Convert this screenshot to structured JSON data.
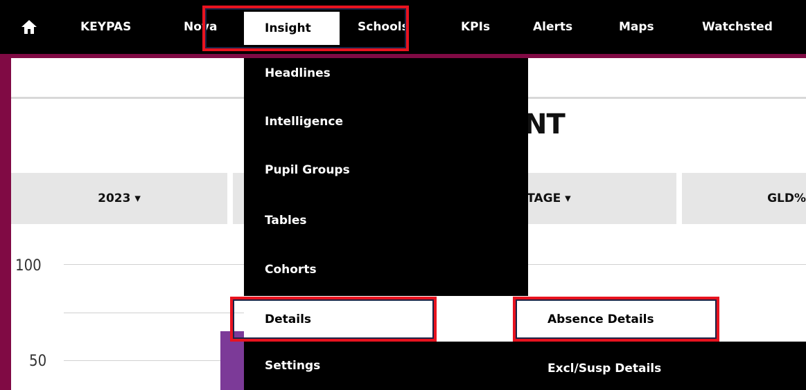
{
  "nav": {
    "home_icon": "home-icon",
    "items": [
      "KEYPAS",
      "Nova",
      "Insight",
      "Schools",
      "KPIs",
      "Alerts",
      "Maps",
      "Watchsted"
    ],
    "active": "Insight"
  },
  "page": {
    "title_partial": "NT"
  },
  "filters": {
    "year": "2023 ▾",
    "stage": "STAGE ▾",
    "measure": "GLD%"
  },
  "chart_data": {
    "type": "bar",
    "ylim": [
      0,
      100
    ],
    "yticks": [
      "100",
      "50"
    ]
  },
  "dropdown": {
    "items": [
      "Headlines",
      "Intelligence",
      "Pupil Groups",
      "Tables",
      "Cohorts",
      "Details",
      "Settings"
    ],
    "selected": "Details"
  },
  "submenu": {
    "items": [
      "Absence Details",
      "Excl/Susp Details"
    ],
    "selected": "Absence Details"
  },
  "colors": {
    "brand": "#800a44",
    "highlight": "#e8131f",
    "bar": "#7c3a98"
  }
}
